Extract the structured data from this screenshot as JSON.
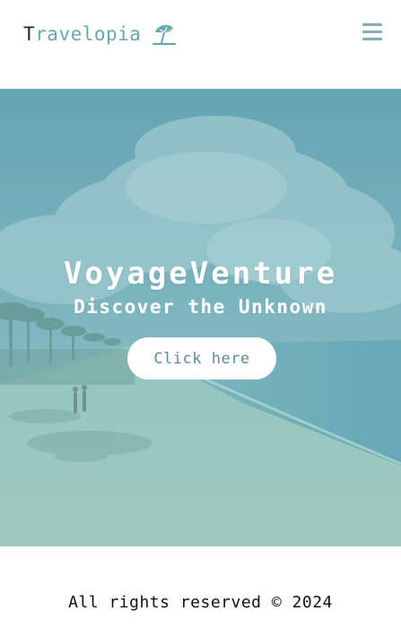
{
  "header": {
    "logo_first_letter": "T",
    "logo_rest": "ravelopia",
    "logo_icon": "beach-umbrella-icon",
    "menu_icon": "hamburger-menu-icon"
  },
  "hero": {
    "title": "VoyageVenture",
    "subtitle": "Discover the Unknown",
    "button_label": "Click here"
  },
  "footer": {
    "text": "All rights reserved © 2024"
  },
  "colors": {
    "accent": "#6aa6ad",
    "logo_dark": "#1f2a2d",
    "hero_overlay": "#78b2bd",
    "button_text": "#5a8f95"
  }
}
